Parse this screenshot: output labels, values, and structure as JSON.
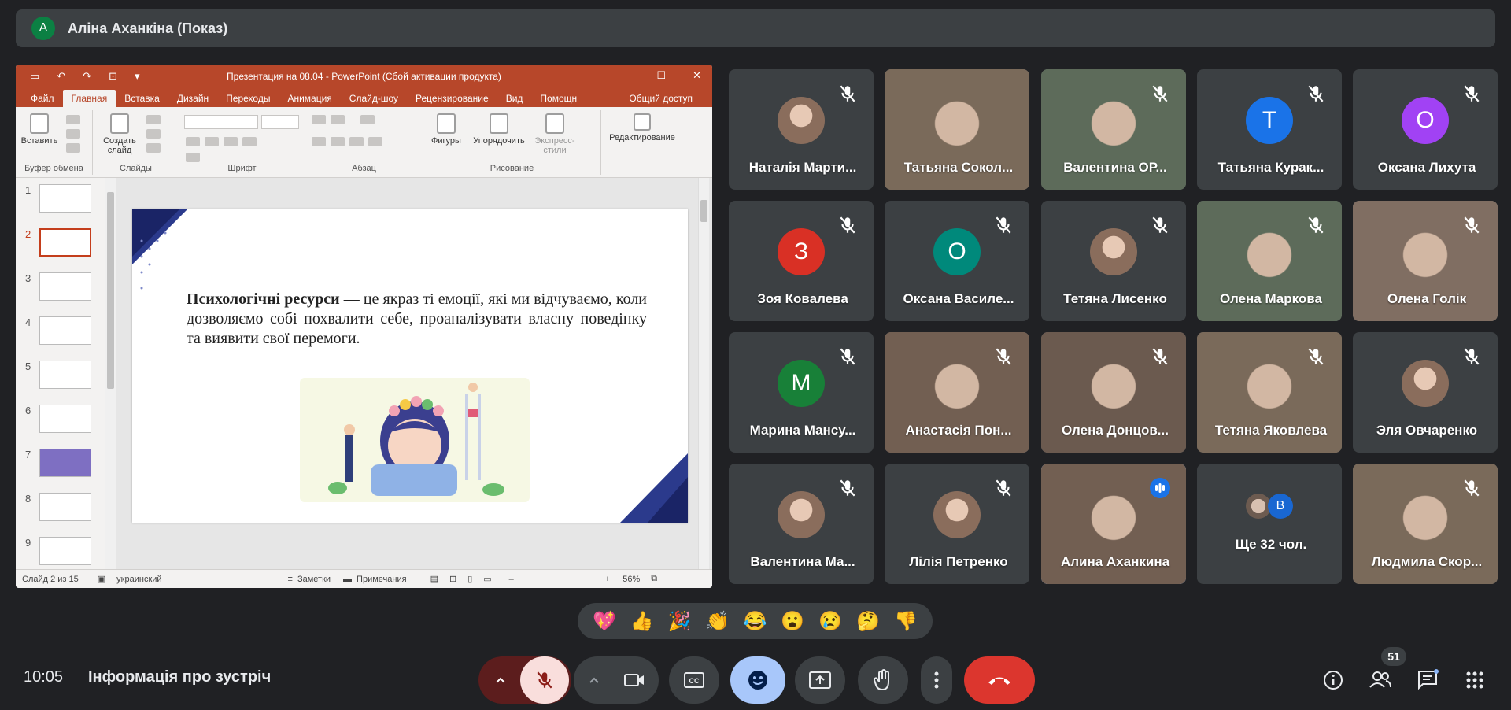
{
  "presenter": {
    "initial": "A",
    "name": "Аліна Аханкіна (Показ)"
  },
  "powerpoint": {
    "title": "Презентация на 08.04 - PowerPoint (Сбой активации продукта)",
    "tabs": [
      "Файл",
      "Главная",
      "Вставка",
      "Дизайн",
      "Переходы",
      "Анимация",
      "Слайд-шоу",
      "Рецензирование",
      "Вид",
      "Помощн"
    ],
    "share_label": "Общий доступ",
    "ribbon": {
      "paste": "Вставить",
      "create_slide": "Создать слайд",
      "shapes": "Фигуры",
      "arrange": "Упорядочить",
      "express_styles": "Экспресс-стили",
      "editing": "Редактирование",
      "groups": [
        "Буфер обмена",
        "Слайды",
        "Шрифт",
        "Абзац",
        "Рисование"
      ]
    },
    "slide_numbers": [
      "1",
      "2",
      "3",
      "4",
      "5",
      "6",
      "7",
      "8",
      "9"
    ],
    "slide_text_bold": "Психологічні ресурси",
    "slide_text_rest": " — це якраз ті емоції, які ми відчуваємо, коли дозволяємо собі похвалити себе, проаналізувати власну поведінку та виявити свої перемоги.",
    "status": {
      "slide_of": "Слайд 2 из 15",
      "language": "украинский",
      "notes": "Заметки",
      "comments": "Примечания",
      "zoom": "56%"
    }
  },
  "participants": [
    {
      "name": "Наталія Марти...",
      "kind": "photo",
      "muted": true
    },
    {
      "name": "Татьяна Сокол...",
      "kind": "video",
      "muted": false
    },
    {
      "name": "Валентина ОР...",
      "kind": "video",
      "muted": true
    },
    {
      "name": "Татьяна Курак...",
      "kind": "initial",
      "initial": "T",
      "color": "#1a73e8",
      "muted": true
    },
    {
      "name": "Оксана Лихута",
      "kind": "initial",
      "initial": "O",
      "color": "#a142f4",
      "muted": true
    },
    {
      "name": "Зоя Ковалева",
      "kind": "initial",
      "initial": "З",
      "color": "#d93025",
      "muted": true
    },
    {
      "name": "Оксана Василе...",
      "kind": "initial",
      "initial": "O",
      "color": "#00897b",
      "muted": true
    },
    {
      "name": "Тетяна Лисенко",
      "kind": "photo",
      "muted": true
    },
    {
      "name": "Олена Маркова",
      "kind": "video",
      "muted": true
    },
    {
      "name": "Олена Голік",
      "kind": "video",
      "muted": true
    },
    {
      "name": "Марина Мансу...",
      "kind": "initial",
      "initial": "M",
      "color": "#188038",
      "muted": true
    },
    {
      "name": "Анастасія Пон...",
      "kind": "video",
      "muted": true
    },
    {
      "name": "Олена Донцов...",
      "kind": "video",
      "muted": true
    },
    {
      "name": "Тетяна Яковлева",
      "kind": "video",
      "muted": true
    },
    {
      "name": "Эля Овчаренко",
      "kind": "photo",
      "muted": true
    },
    {
      "name": "Валентина Ма...",
      "kind": "photo",
      "muted": true
    },
    {
      "name": "Лілія Петренко",
      "kind": "photo",
      "muted": true
    },
    {
      "name": "Алина Аханкина",
      "kind": "video",
      "muted": false,
      "speaking": true
    },
    {
      "name": "Ще 32 чол.",
      "kind": "more",
      "muted": false
    },
    {
      "name": "Людмила Скор...",
      "kind": "video",
      "muted": true
    }
  ],
  "more_initial": "B",
  "reactions": [
    "💖",
    "👍",
    "🎉",
    "👏",
    "😂",
    "😮",
    "😢",
    "🤔",
    "👎"
  ],
  "bottom": {
    "time": "10:05",
    "meeting_info": "Інформація про зустріч",
    "people_count": "51",
    "icons": [
      "info-icon",
      "people-icon",
      "chat-icon",
      "apps-icon"
    ]
  }
}
